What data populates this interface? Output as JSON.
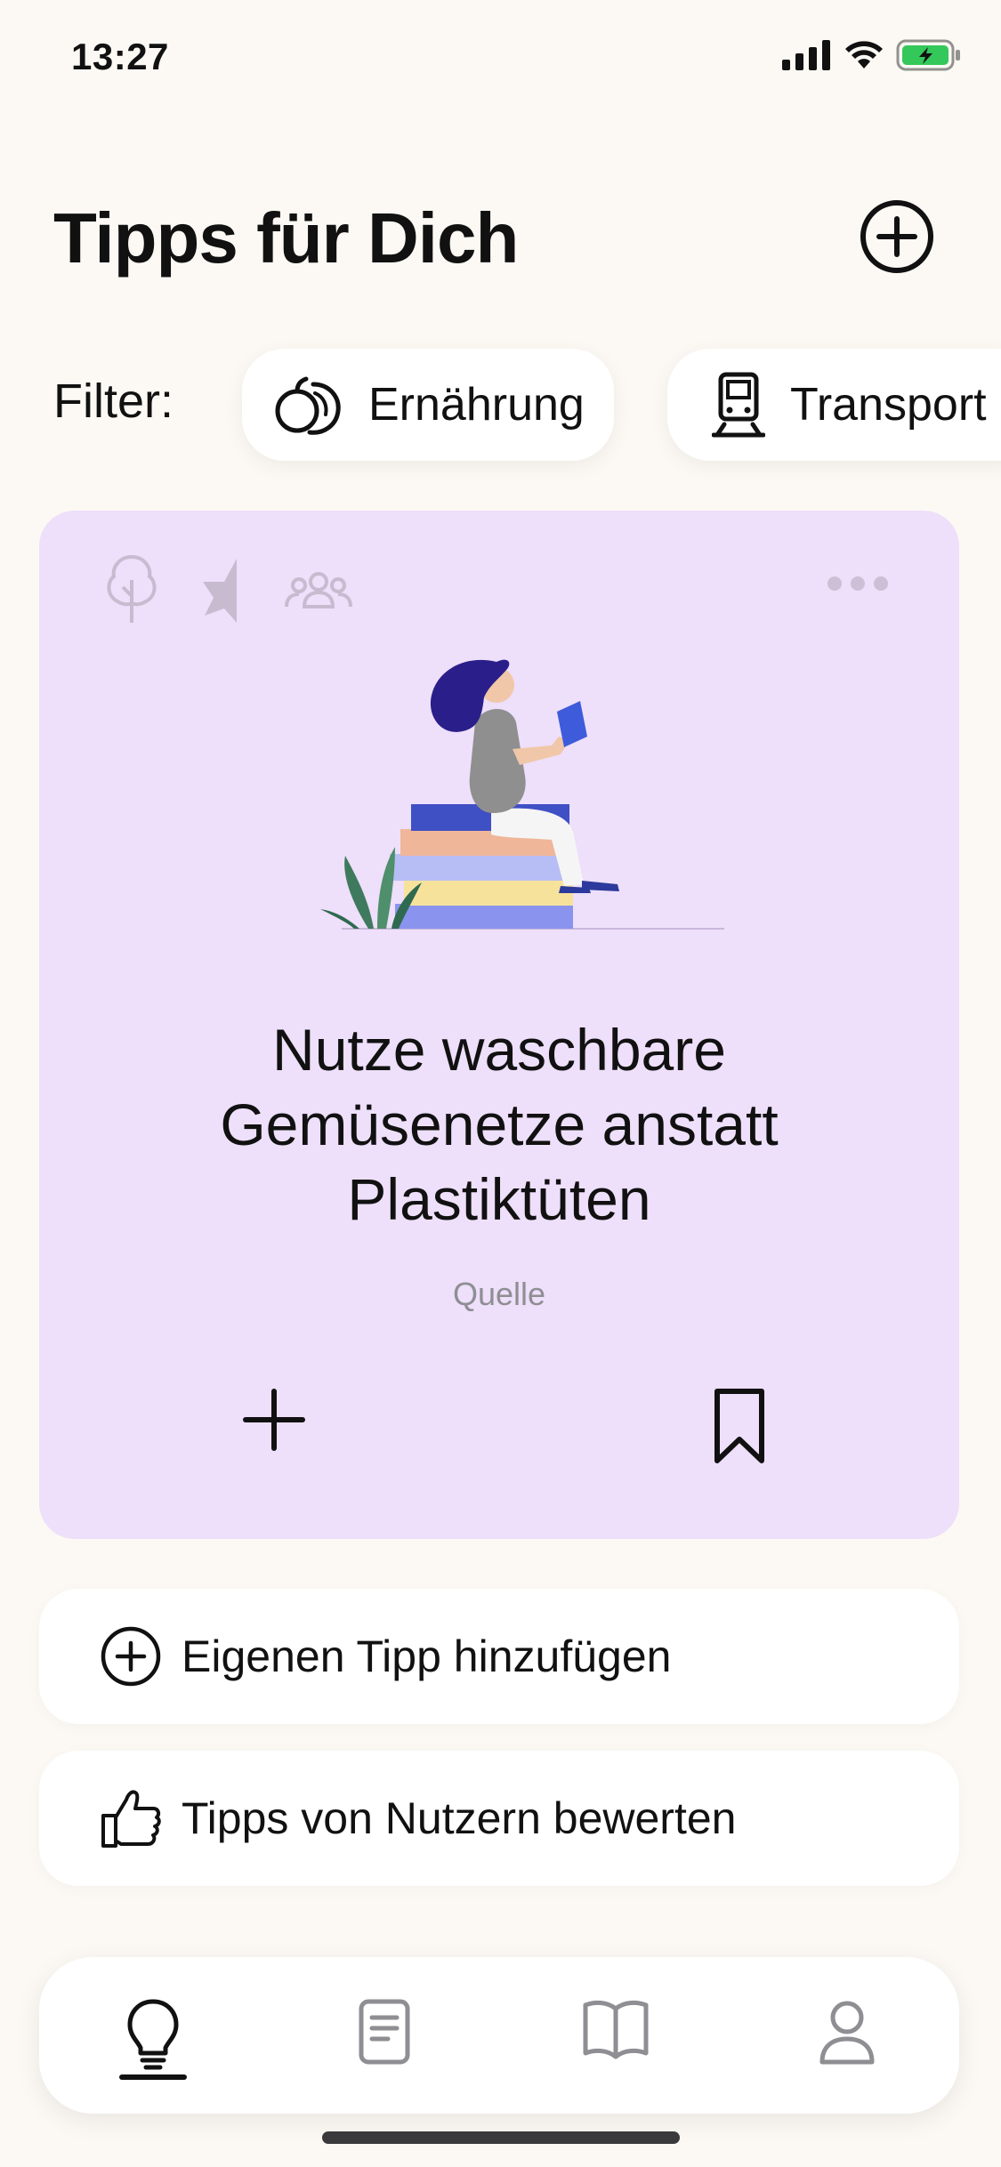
{
  "status_bar": {
    "time": "13:27",
    "battery_color": "#34c759"
  },
  "header": {
    "title": "Tipps für Dich",
    "add_icon": "plus-circle-icon"
  },
  "filter": {
    "label": "Filter:",
    "chips": [
      {
        "label": "Ernährung",
        "icon": "fruit-icon"
      },
      {
        "label": "Transport",
        "icon": "train-icon"
      }
    ]
  },
  "tip_card": {
    "background": "#eedffa",
    "title": "Nutze waschbare Gemüsenetze anstatt Plastiktüten",
    "source": "Quelle",
    "add_icon": "plus-icon",
    "bookmark_icon": "bookmark-icon"
  },
  "actions": {
    "add_tip": "Eigenen Tipp hinzufügen",
    "rate_tips": "Tipps von Nutzern bewerten"
  },
  "tab_bar": {
    "tabs": [
      {
        "icon": "lightbulb-icon",
        "active": true
      },
      {
        "icon": "document-icon",
        "active": false
      },
      {
        "icon": "book-icon",
        "active": false
      },
      {
        "icon": "person-icon",
        "active": false
      }
    ]
  }
}
